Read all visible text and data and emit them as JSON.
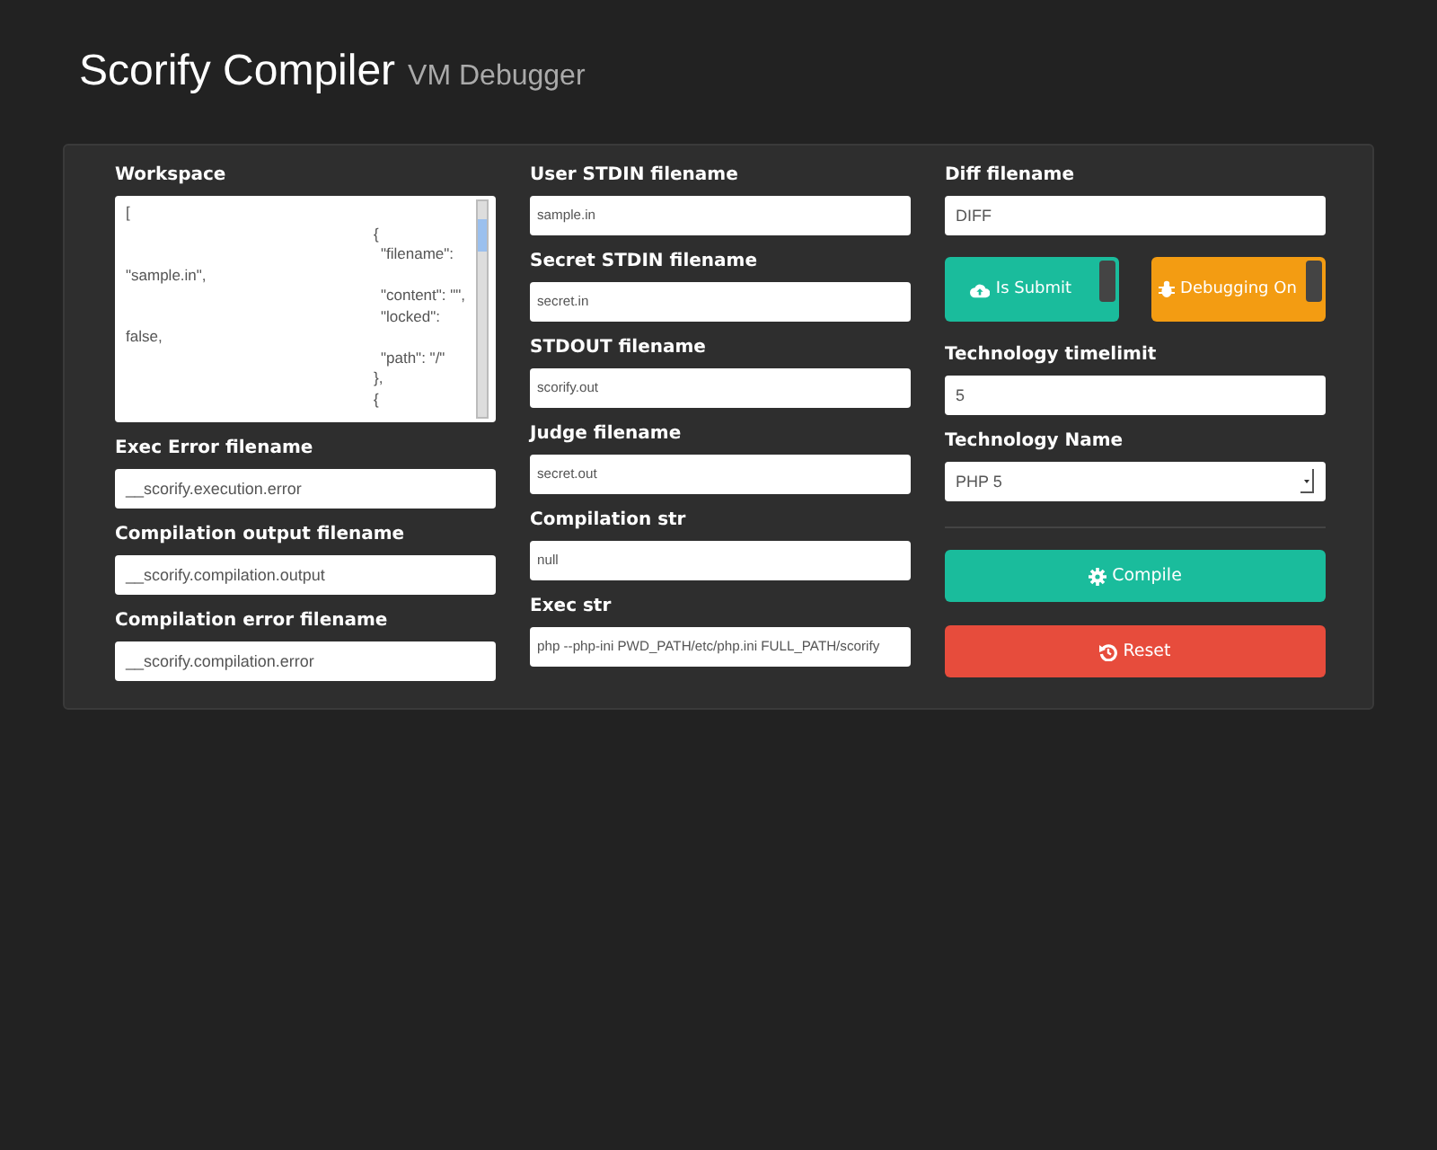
{
  "header": {
    "title": "Scorify Compiler",
    "subtitle": "VM Debugger"
  },
  "workspace": {
    "label": "Workspace",
    "lines": [
      {
        "text": "[",
        "kind": "plain"
      },
      {
        "text": "{",
        "kind": "brace"
      },
      {
        "text": "\"filename\":",
        "kind": "key"
      },
      {
        "text": "\"sample.in\",",
        "kind": "plain"
      },
      {
        "text": "\"content\": \"\",",
        "kind": "key"
      },
      {
        "text": "\"locked\":",
        "kind": "key"
      },
      {
        "text": "false,",
        "kind": "plain"
      },
      {
        "text": "\"path\": \"/\"",
        "kind": "key"
      },
      {
        "text": "},",
        "kind": "brace"
      },
      {
        "text": "{",
        "kind": "brace"
      }
    ]
  },
  "column_1": [
    {
      "label": "Exec Error filename",
      "value": "__scorify.execution.error"
    },
    {
      "label": "Compilation output filename",
      "value": "__scorify.compilation.output"
    },
    {
      "label": "Compilation error filename",
      "value": "__scorify.compilation.error"
    }
  ],
  "column_2": [
    {
      "label": "User STDIN filename",
      "value": "sample.in"
    },
    {
      "label": "Secret STDIN filename",
      "value": "secret.in"
    },
    {
      "label": "STDOUT filename",
      "value": "scorify.out"
    },
    {
      "label": "Judge filename",
      "value": "secret.out"
    },
    {
      "label": "Compilation str",
      "value": "null"
    },
    {
      "label": "Exec str",
      "value": "php --php-ini PWD_PATH/etc/php.ini FULL_PATH/scorify"
    }
  ],
  "diff": {
    "label": "Diff filename",
    "value": "DIFF"
  },
  "toggles": [
    {
      "label": "Is Submit",
      "kind": "cloud",
      "on": true,
      "color": "#1abc9c"
    },
    {
      "label": "Debugging On",
      "kind": "bug",
      "on": true,
      "color": "#f39c12"
    }
  ],
  "timelimit": {
    "label": "Technology timelimit",
    "value": "5"
  },
  "technology": {
    "label": "Technology Name",
    "value": "PHP 5"
  },
  "actions": [
    {
      "label": "Compile",
      "kind": "compile"
    },
    {
      "label": "Reset",
      "kind": "reset"
    }
  ]
}
